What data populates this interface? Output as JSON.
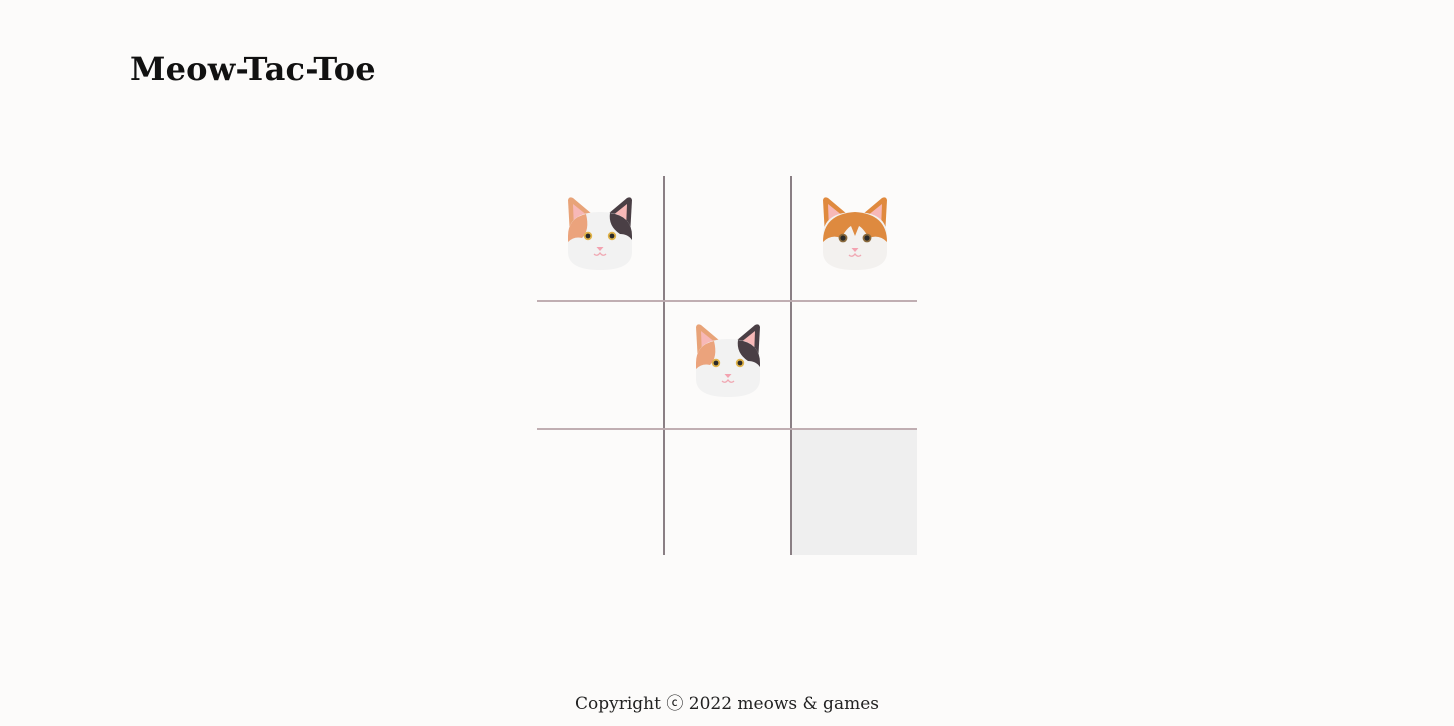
{
  "header": {
    "title": "Meow-Tac-Toe"
  },
  "board": {
    "cells": [
      {
        "row": 1,
        "col": 1,
        "mark": "calico-cat"
      },
      {
        "row": 1,
        "col": 2,
        "mark": ""
      },
      {
        "row": 1,
        "col": 3,
        "mark": "orange-cat"
      },
      {
        "row": 2,
        "col": 1,
        "mark": ""
      },
      {
        "row": 2,
        "col": 2,
        "mark": "calico-cat"
      },
      {
        "row": 2,
        "col": 3,
        "mark": ""
      },
      {
        "row": 3,
        "col": 1,
        "mark": ""
      },
      {
        "row": 3,
        "col": 2,
        "mark": ""
      },
      {
        "row": 3,
        "col": 3,
        "mark": "",
        "state": "hovered"
      }
    ],
    "colors": {
      "vertical_line": "#8a7f84",
      "horizontal_line": "#c0aeb2",
      "hover_cell": "#efefef"
    }
  },
  "footer": {
    "copyright": "Copyright ⓒ 2022 meows & games"
  },
  "colors": {
    "background": "#fcfbfa",
    "text": "#111111"
  }
}
